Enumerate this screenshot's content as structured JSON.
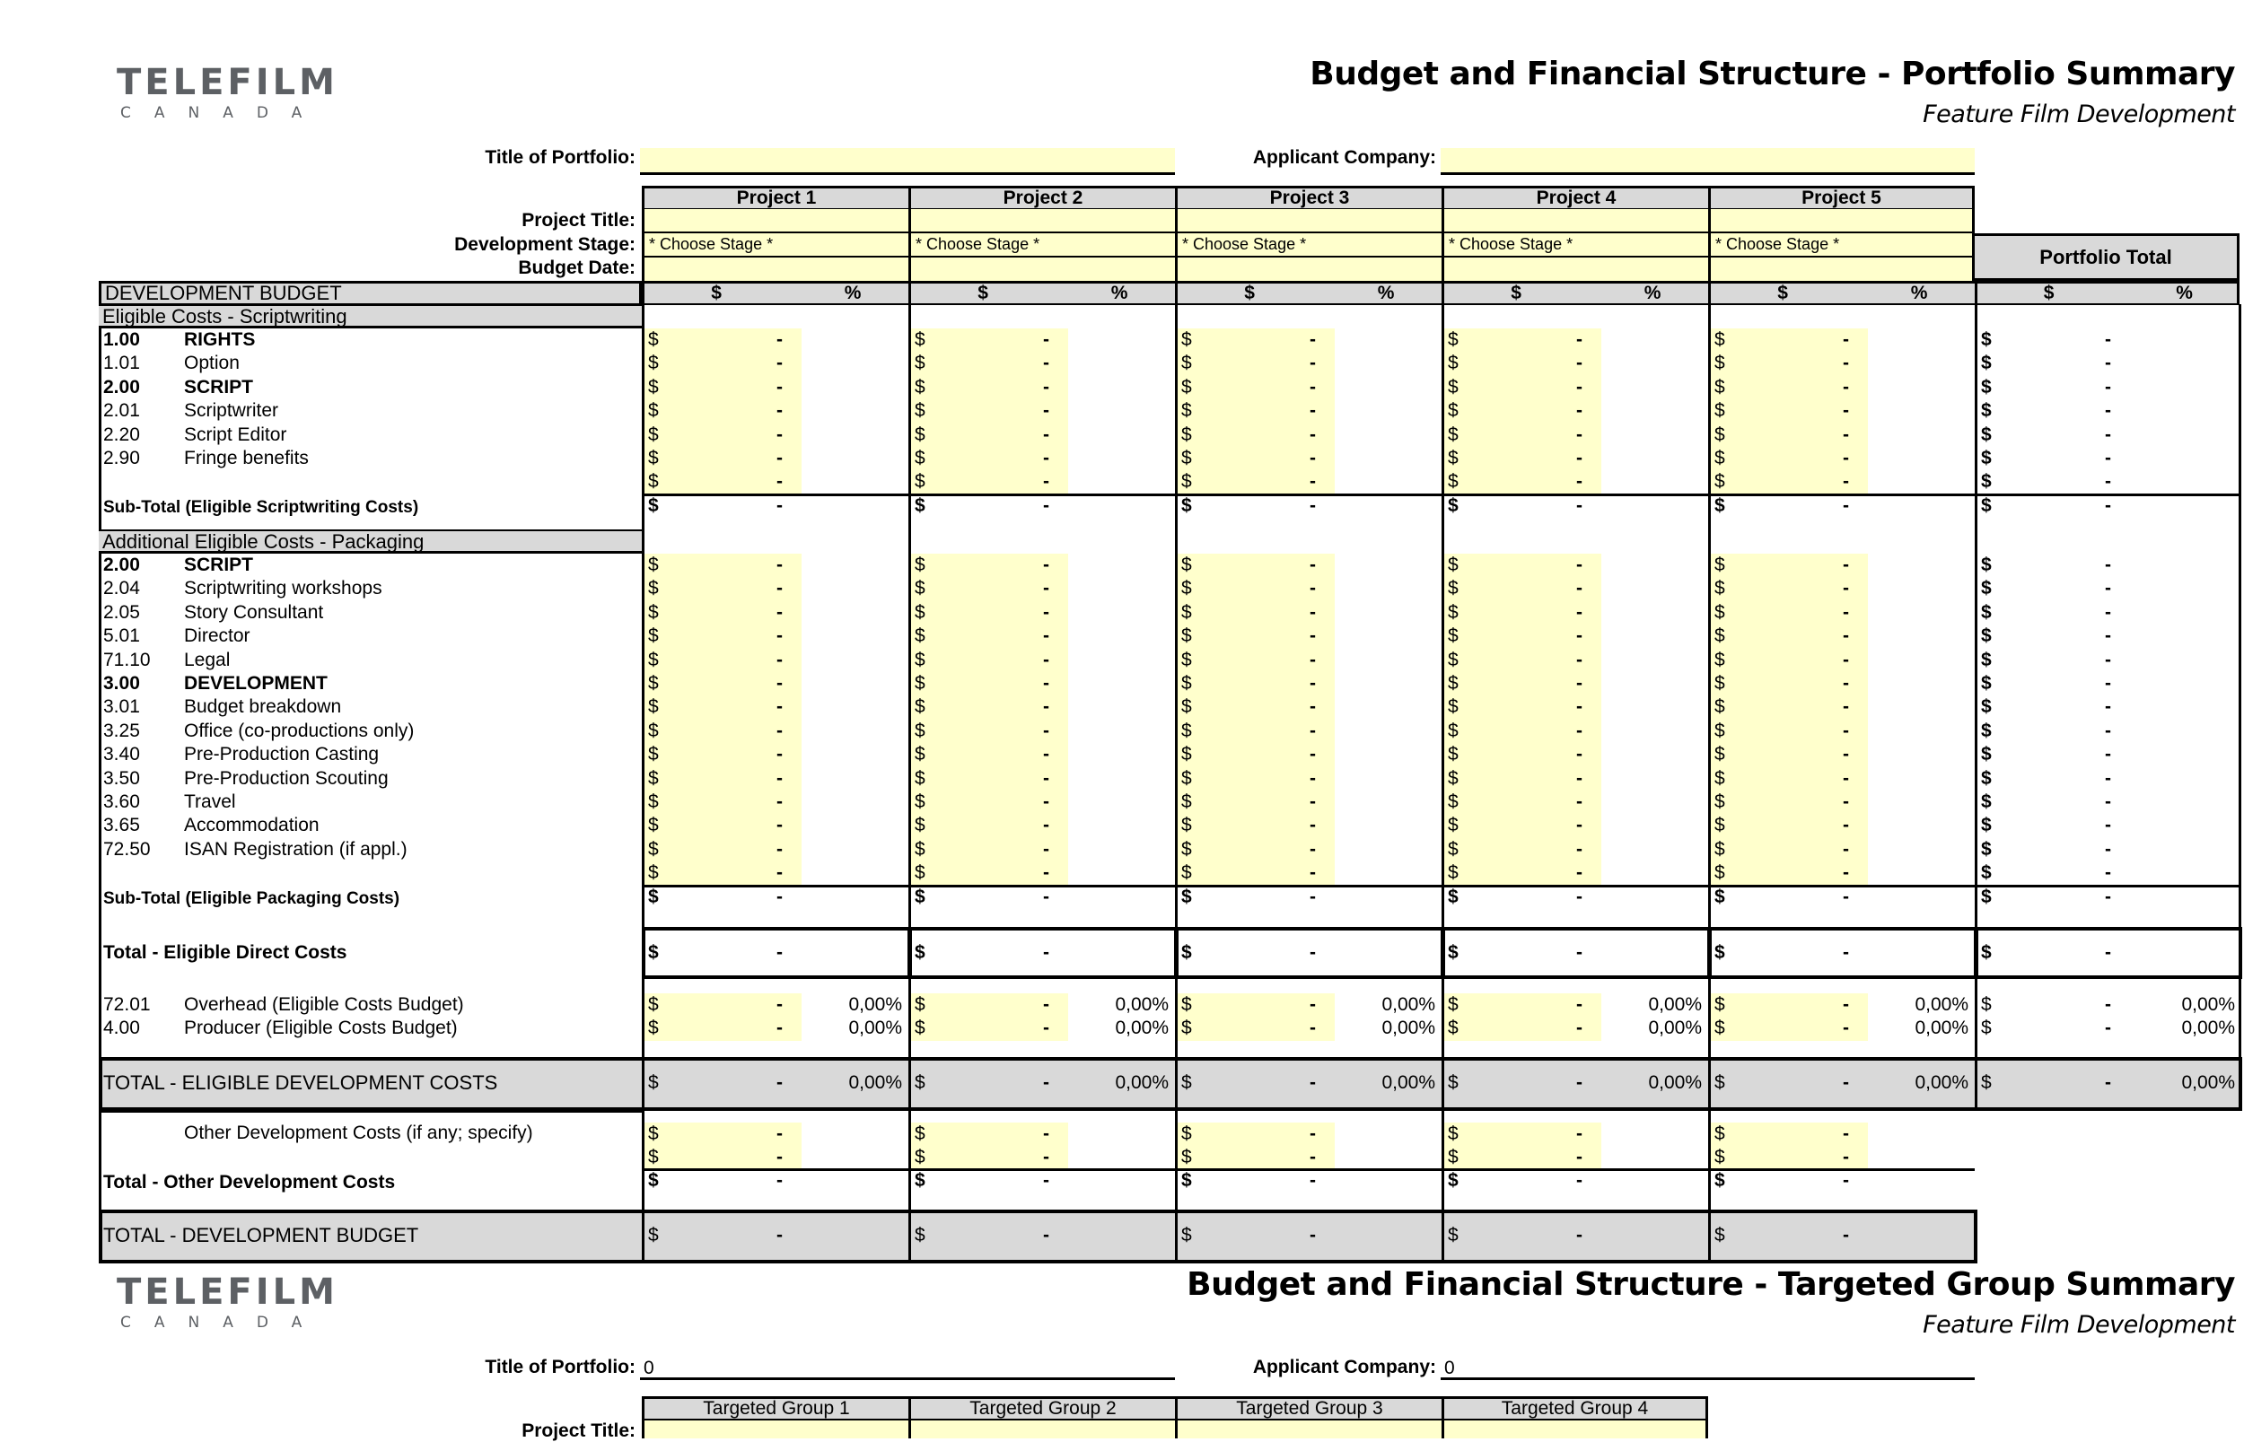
{
  "logo": {
    "main": "TELEFILM",
    "sub": "CANADA"
  },
  "portfolio_summary": {
    "title": "Budget and Financial Structure - Portfolio Summary",
    "subtitle": "Feature Film Development",
    "title_of_portfolio_label": "Title of Portfolio:",
    "title_of_portfolio_value": "",
    "applicant_company_label": "Applicant Company:",
    "applicant_company_value": "",
    "row_labels": {
      "project_title": "Project Title:",
      "development_stage": "Development Stage:",
      "budget_date": "Budget Date:"
    },
    "projects": [
      {
        "name": "Project 1",
        "stage": "* Choose Stage *"
      },
      {
        "name": "Project 2",
        "stage": "* Choose Stage *"
      },
      {
        "name": "Project 3",
        "stage": "* Choose Stage *"
      },
      {
        "name": "Project 4",
        "stage": "* Choose Stage *"
      },
      {
        "name": "Project 5",
        "stage": "* Choose Stage *"
      }
    ],
    "portfolio_total_label": "Portfolio Total",
    "col_dollar": "$",
    "col_pct": "%",
    "development_budget_label": "DEVELOPMENT BUDGET",
    "sections": {
      "scriptwriting": {
        "header": "Eligible Costs - Scriptwriting",
        "items": [
          {
            "code": "1.00",
            "label": "RIGHTS",
            "bold": true
          },
          {
            "code": "1.01",
            "label": "Option",
            "bold": false
          },
          {
            "code": "2.00",
            "label": "SCRIPT",
            "bold": true
          },
          {
            "code": "2.01",
            "label": "Scriptwriter",
            "bold": false
          },
          {
            "code": "2.20",
            "label": "Script Editor",
            "bold": false
          },
          {
            "code": "2.90",
            "label": "Fringe benefits",
            "bold": false
          },
          {
            "code": "",
            "label": "",
            "bold": false
          }
        ],
        "subtotal": "Sub-Total (Eligible Scriptwriting Costs)"
      },
      "packaging": {
        "header": "Additional Eligible Costs - Packaging",
        "items": [
          {
            "code": "2.00",
            "label": "SCRIPT",
            "bold": true
          },
          {
            "code": "2.04",
            "label": "Scriptwriting workshops",
            "bold": false
          },
          {
            "code": "2.05",
            "label": "Story Consultant",
            "bold": false
          },
          {
            "code": "5.01",
            "label": "Director",
            "bold": false
          },
          {
            "code": "71.10",
            "label": "Legal",
            "bold": false
          },
          {
            "code": "3.00",
            "label": "DEVELOPMENT",
            "bold": true
          },
          {
            "code": "3.01",
            "label": "Budget breakdown",
            "bold": false
          },
          {
            "code": "3.25",
            "label": "Office (co-productions only)",
            "bold": false
          },
          {
            "code": "3.40",
            "label": "Pre-Production Casting",
            "bold": false
          },
          {
            "code": "3.50",
            "label": "Pre-Production Scouting",
            "bold": false
          },
          {
            "code": "3.60",
            "label": "Travel",
            "bold": false
          },
          {
            "code": "3.65",
            "label": "Accommodation",
            "bold": false
          },
          {
            "code": "72.50",
            "label": "ISAN Registration (if appl.)",
            "bold": false
          },
          {
            "code": "",
            "label": "",
            "bold": false
          }
        ],
        "subtotal": "Sub-Total (Eligible Packaging Costs)"
      }
    },
    "total_eligible_direct": "Total - Eligible Direct Costs",
    "overhead": {
      "code": "72.01",
      "label": "Overhead (Eligible Costs Budget)"
    },
    "producer": {
      "code": "4.00",
      "label": "Producer (Eligible Costs Budget)"
    },
    "total_eligible_dev": "TOTAL - ELIGIBLE DEVELOPMENT COSTS",
    "other_dev": "Other Development Costs (if any; specify)",
    "total_other_dev": "Total - Other Development Costs",
    "total_dev_budget": "TOTAL - DEVELOPMENT BUDGET",
    "currency_symbol": "$",
    "empty_value": "-",
    "pct_value": "0,00%"
  },
  "targeted_summary": {
    "title": "Budget and Financial Structure - Targeted Group Summary",
    "subtitle": "Feature Film Development",
    "title_of_portfolio_label": "Title of Portfolio:",
    "title_of_portfolio_value": "0",
    "applicant_company_label": "Applicant Company:",
    "applicant_company_value": "0",
    "groups": [
      "Targeted Group 1",
      "Targeted Group 2",
      "Targeted Group 3",
      "Targeted Group 4"
    ],
    "project_title_label": "Project Title:"
  },
  "colors": {
    "input_fill": "#ffffcc",
    "header_fill": "#d9d9d9",
    "logo_gray": "#5d6064"
  }
}
